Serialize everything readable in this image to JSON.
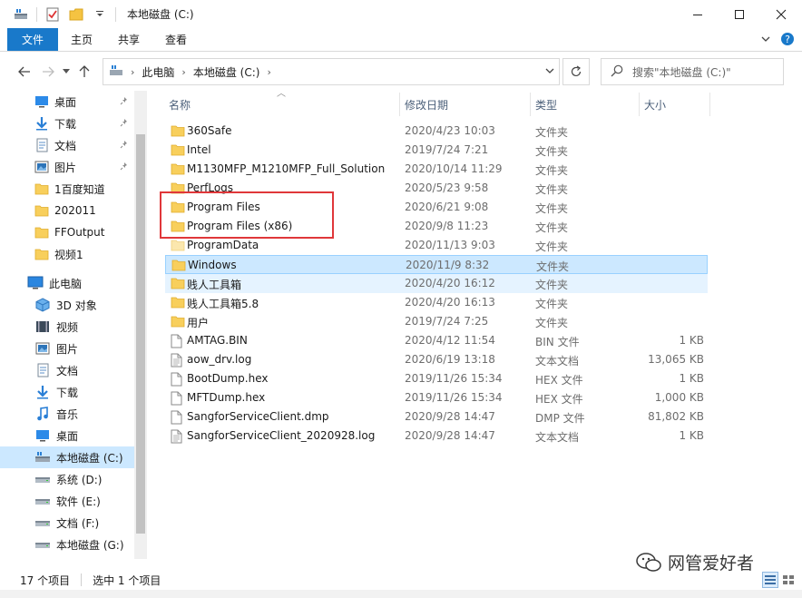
{
  "window": {
    "title": "本地磁盘 (C:)",
    "accent_color": "#1979ca"
  },
  "ribbon": {
    "tabs": [
      "文件",
      "主页",
      "共享",
      "查看"
    ]
  },
  "address": {
    "breadcrumb": [
      "此电脑",
      "本地磁盘 (C:)"
    ],
    "search_placeholder": "搜索\"本地磁盘 (C:)\""
  },
  "nav": {
    "quick_access": [
      {
        "label": "桌面",
        "icon": "desktop-icon",
        "pinned": true
      },
      {
        "label": "下载",
        "icon": "download-icon",
        "pinned": true
      },
      {
        "label": "文档",
        "icon": "document-icon",
        "pinned": true
      },
      {
        "label": "图片",
        "icon": "picture-icon",
        "pinned": true
      },
      {
        "label": "1百度知道",
        "icon": "folder-icon",
        "pinned": false
      },
      {
        "label": "202011",
        "icon": "folder-icon",
        "pinned": false
      },
      {
        "label": "FFOutput",
        "icon": "folder-icon",
        "pinned": false
      },
      {
        "label": "视频1",
        "icon": "folder-icon",
        "pinned": false
      }
    ],
    "this_pc": "此电脑",
    "pc_items": [
      {
        "label": "3D 对象",
        "icon": "3d-objects-icon"
      },
      {
        "label": "视频",
        "icon": "video-icon"
      },
      {
        "label": "图片",
        "icon": "picture-icon"
      },
      {
        "label": "文档",
        "icon": "document-icon"
      },
      {
        "label": "下载",
        "icon": "download-icon"
      },
      {
        "label": "音乐",
        "icon": "music-icon"
      },
      {
        "label": "桌面",
        "icon": "desktop-icon"
      },
      {
        "label": "本地磁盘 (C:)",
        "icon": "system-drive-icon",
        "selected": true
      },
      {
        "label": "系统 (D:)",
        "icon": "drive-icon"
      },
      {
        "label": "软件 (E:)",
        "icon": "drive-icon"
      },
      {
        "label": "文档 (F:)",
        "icon": "drive-icon"
      },
      {
        "label": "本地磁盘 (G:)",
        "icon": "drive-icon"
      }
    ]
  },
  "list": {
    "columns": {
      "name": "名称",
      "modified": "修改日期",
      "type": "类型",
      "size": "大小"
    },
    "files": [
      {
        "name": "360Safe",
        "date": "2020/4/23 10:03",
        "type": "文件夹",
        "size": "",
        "kind": "folder"
      },
      {
        "name": "Intel",
        "date": "2019/7/24 7:21",
        "type": "文件夹",
        "size": "",
        "kind": "folder"
      },
      {
        "name": "M1130MFP_M1210MFP_Full_Solution",
        "date": "2020/10/14 11:29",
        "type": "文件夹",
        "size": "",
        "kind": "folder"
      },
      {
        "name": "PerfLogs",
        "date": "2020/5/23 9:58",
        "type": "文件夹",
        "size": "",
        "kind": "folder"
      },
      {
        "name": "Program Files",
        "date": "2020/6/21 9:08",
        "type": "文件夹",
        "size": "",
        "kind": "folder"
      },
      {
        "name": "Program Files (x86)",
        "date": "2020/9/8 11:23",
        "type": "文件夹",
        "size": "",
        "kind": "folder"
      },
      {
        "name": "ProgramData",
        "date": "2020/11/13 9:03",
        "type": "文件夹",
        "size": "",
        "kind": "folder-hidden"
      },
      {
        "name": "Windows",
        "date": "2020/11/9 8:32",
        "type": "文件夹",
        "size": "",
        "kind": "folder",
        "state": "selected"
      },
      {
        "name": "贱人工具箱",
        "date": "2020/4/20 16:12",
        "type": "文件夹",
        "size": "",
        "kind": "folder",
        "state": "hover"
      },
      {
        "name": "贱人工具箱5.8",
        "date": "2020/4/20 16:13",
        "type": "文件夹",
        "size": "",
        "kind": "folder"
      },
      {
        "name": "用户",
        "date": "2019/7/24 7:25",
        "type": "文件夹",
        "size": "",
        "kind": "folder"
      },
      {
        "name": "AMTAG.BIN",
        "date": "2020/4/12 11:54",
        "type": "BIN 文件",
        "size": "1 KB",
        "kind": "file"
      },
      {
        "name": "aow_drv.log",
        "date": "2020/6/19 13:18",
        "type": "文本文档",
        "size": "13,065 KB",
        "kind": "text"
      },
      {
        "name": "BootDump.hex",
        "date": "2019/11/26 15:34",
        "type": "HEX 文件",
        "size": "1 KB",
        "kind": "file"
      },
      {
        "name": "MFTDump.hex",
        "date": "2019/11/26 15:34",
        "type": "HEX 文件",
        "size": "1,000 KB",
        "kind": "file"
      },
      {
        "name": "SangforServiceClient.dmp",
        "date": "2020/9/28 14:47",
        "type": "DMP 文件",
        "size": "81,802 KB",
        "kind": "file"
      },
      {
        "name": "SangforServiceClient_2020928.log",
        "date": "2020/9/28 14:47",
        "type": "文本文档",
        "size": "1 KB",
        "kind": "text"
      }
    ]
  },
  "status": {
    "count": "17 个项目",
    "selection": "选中 1 个项目"
  },
  "watermark": "网管爱好者"
}
